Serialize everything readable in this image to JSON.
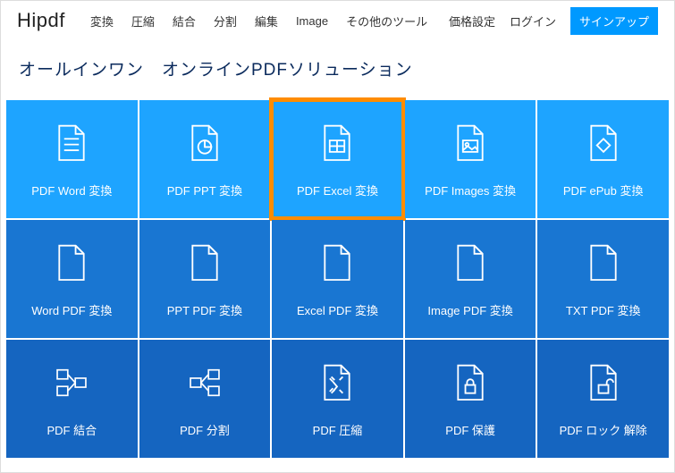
{
  "header": {
    "logo": "Hipdf",
    "nav": [
      "変換",
      "圧縮",
      "結合",
      "分割",
      "編集",
      "Image",
      "その他のツール"
    ],
    "right": {
      "pricing": "価格設定",
      "login": "ログイン",
      "signup": "サインアップ"
    }
  },
  "title": "オールインワン　オンラインPDFソリューション",
  "tiles": [
    {
      "label": "PDF Word 変換",
      "icon": "doc-lines",
      "row": 1,
      "highlight": false
    },
    {
      "label": "PDF PPT 変換",
      "icon": "doc-pie",
      "row": 1,
      "highlight": false
    },
    {
      "label": "PDF Excel 変換",
      "icon": "doc-grid",
      "row": 1,
      "highlight": true
    },
    {
      "label": "PDF Images 変換",
      "icon": "doc-image",
      "row": 1,
      "highlight": false
    },
    {
      "label": "PDF ePub 変換",
      "icon": "doc-diamond",
      "row": 1,
      "highlight": false
    },
    {
      "label": "Word PDF 変換",
      "icon": "file-corner",
      "row": 2,
      "highlight": false
    },
    {
      "label": "PPT PDF 変換",
      "icon": "file-corner",
      "row": 2,
      "highlight": false
    },
    {
      "label": "Excel PDF 変換",
      "icon": "file-corner",
      "row": 2,
      "highlight": false
    },
    {
      "label": "Image PDF 変換",
      "icon": "file-corner",
      "row": 2,
      "highlight": false
    },
    {
      "label": "TXT PDF 変換",
      "icon": "file-corner",
      "row": 2,
      "highlight": false
    },
    {
      "label": "PDF 結合",
      "icon": "merge",
      "row": 3,
      "highlight": false
    },
    {
      "label": "PDF 分割",
      "icon": "split",
      "row": 3,
      "highlight": false
    },
    {
      "label": "PDF 圧縮",
      "icon": "compress",
      "row": 3,
      "highlight": false
    },
    {
      "label": "PDF 保護",
      "icon": "lock",
      "row": 3,
      "highlight": false
    },
    {
      "label": "PDF ロック 解除",
      "icon": "unlock",
      "row": 3,
      "highlight": false
    }
  ]
}
